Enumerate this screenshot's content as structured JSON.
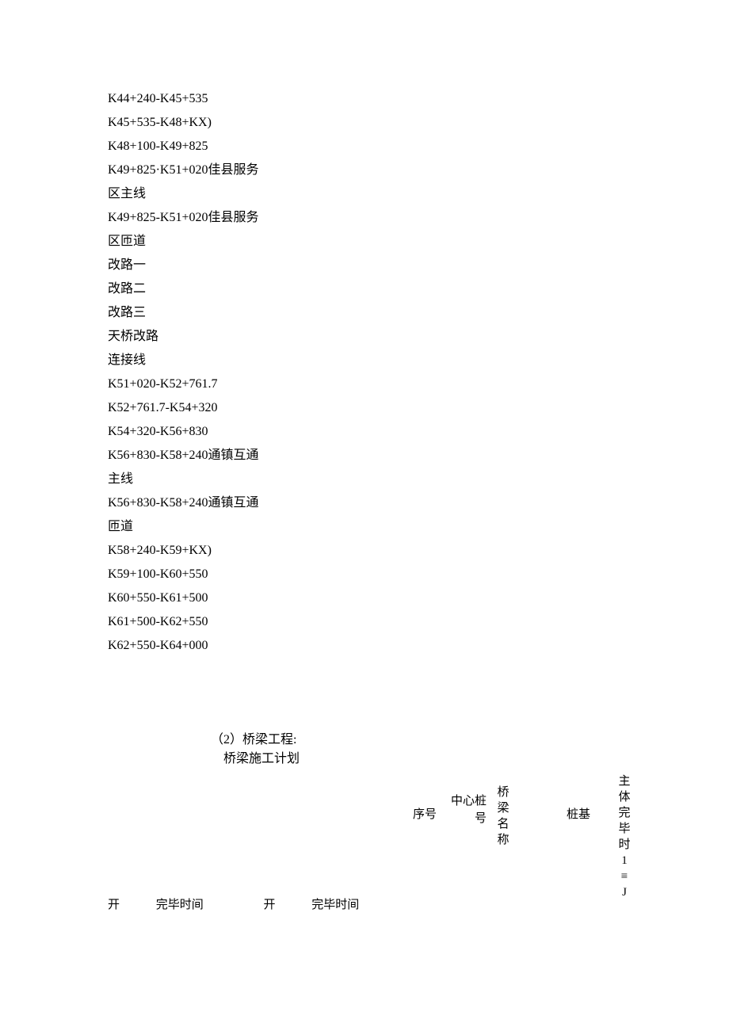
{
  "list_items": [
    "K44+240-K45+535",
    "K45+535-K48+KX)",
    "K48+100-K49+825",
    "K49+825·K51+020佳县服务区主线",
    "K49+825-K51+020佳县服务区匝道",
    "改路一",
    "改路二",
    "改路三",
    "天桥改路",
    "连接线",
    "K51+020-K52+761.7",
    "K52+761.7-K54+320",
    "K54+320-K56+830",
    "K56+830-K58+240通镇互通主线",
    "K56+830-K58+240通镇互通匝道",
    "K58+240-K59+KX)",
    "K59+100-K60+550",
    "K60+550-K61+500",
    "K61+500-K62+550",
    "K62+550-K64+000"
  ],
  "section": {
    "line1": "（2）桥梁工程:",
    "line2": "桥梁施工计划"
  },
  "table_headers": {
    "seq": "序号",
    "center_pile": "中心桩号",
    "bridge_name": "桥梁名称",
    "pile_base": "桩基",
    "main_complete": "主体完毕时1≡J"
  },
  "bottom_row": {
    "kai1": "开",
    "complete1": "完毕时间",
    "kai2": "开",
    "complete2": "完毕时间"
  },
  "wrap_indices": [
    3,
    4,
    13,
    14
  ]
}
